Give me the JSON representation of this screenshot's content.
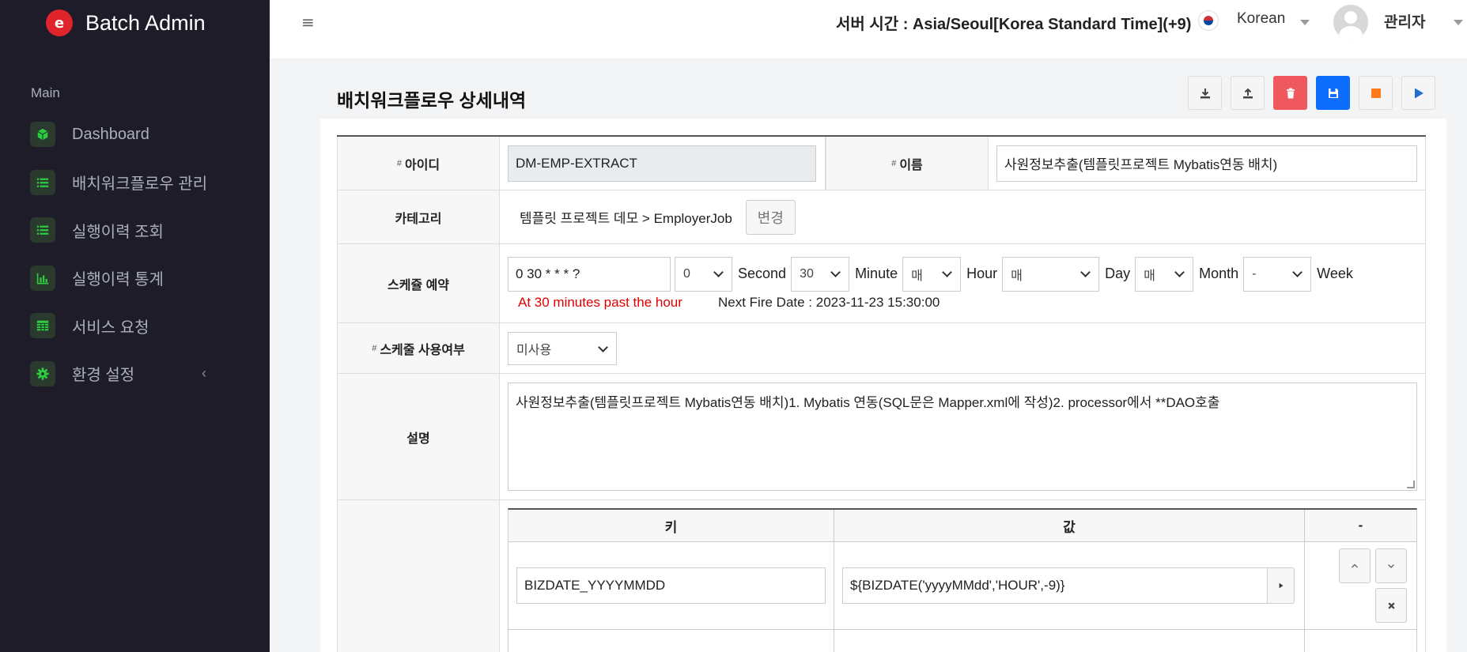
{
  "brand": {
    "name": "Batch Admin",
    "logo_letter": "e"
  },
  "sidebar": {
    "section": "Main",
    "items": [
      {
        "label": "Dashboard",
        "icon": "cube-icon"
      },
      {
        "label": "배치워크플로우 관리",
        "icon": "list-icon"
      },
      {
        "label": "실행이력 조회",
        "icon": "list-icon"
      },
      {
        "label": "실행이력 통계",
        "icon": "bar-chart-icon"
      },
      {
        "label": "서비스 요청",
        "icon": "table-icon"
      },
      {
        "label": "환경 설정",
        "icon": "gear-icon",
        "chevron": "‹"
      }
    ]
  },
  "topbar": {
    "hamburger": "≡",
    "server_time": "서버 시간 : Asia/Seoul[Korea Standard Time](+9)",
    "language": "Korean",
    "user": "관리자"
  },
  "page": {
    "title": "배치워크플로우 상세내역",
    "actions": [
      "download-button",
      "upload-button",
      "delete-button",
      "save-button",
      "stop-button",
      "run-button"
    ]
  },
  "form": {
    "id_label": "아이디",
    "id_value": "DM-EMP-EXTRACT",
    "name_label": "이름",
    "name_value": "사원정보추출(템플릿프로젝트 Mybatis연동 배치)",
    "category_label": "카테고리",
    "category_value": "템플릿 프로젝트 데모 > EmployerJob",
    "category_change": "변경",
    "schedule_label": "스케쥴 예약",
    "cron": "0 30 * * * ?",
    "second_value": "0",
    "second_label": "Second",
    "minute_value": "30",
    "minute_label": "Minute",
    "hour_value": "매",
    "hour_label": "Hour",
    "day_value": "매",
    "day_label": "Day",
    "month_value": "매",
    "month_label": "Month",
    "week_value": "-",
    "week_label": "Week",
    "schedule_desc": "At 30 minutes past the hour",
    "next_fire": "Next Fire Date : 2023-11-23 15:30:00",
    "use_label": "스케줄 사용여부",
    "use_value": "미사용",
    "desc_label": "설명",
    "desc_value": "사원정보추출(템플릿프로젝트 Mybatis연동 배치)1. Mybatis 연동(SQL문은 Mapper.xml에 작성)2. processor에서 **DAO호출",
    "hash": "#"
  },
  "params": {
    "headers": {
      "key": "키",
      "value": "값",
      "action": "-"
    },
    "rows": [
      {
        "key": "BIZDATE_YYYYMMDD",
        "value": "${BIZDATE('yyyyMMdd','HOUR',-9)}"
      }
    ]
  },
  "colors": {
    "sidebar_bg": "#1d1c28",
    "accent_green": "#2ecc40",
    "schedule_desc_red": "#e00000",
    "save_blue": "#0d6efd",
    "delete_red": "#f0585f",
    "stop_orange": "#ff7a1a"
  }
}
